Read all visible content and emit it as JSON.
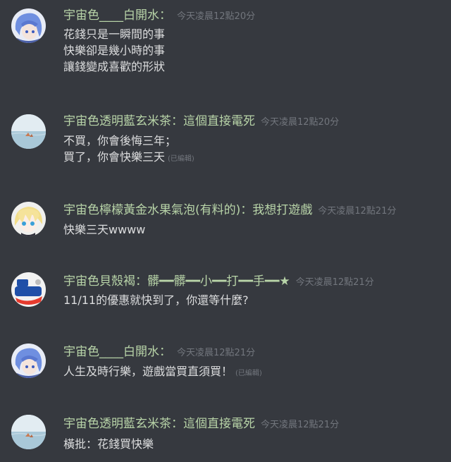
{
  "messages": [
    {
      "author": "宇宙色____白開水：",
      "timestamp": "今天凌晨12點20分",
      "avatar": "blue-hair-anime-avatar",
      "lines": [
        "花錢只是一瞬間的事",
        "快樂卻是幾小時的事",
        "讓錢變成喜歡的形狀"
      ],
      "edited": ""
    },
    {
      "author": "宇宙色透明藍玄米茶：這個直接電死",
      "timestamp": "今天凌晨12點20分",
      "avatar": "sea-scene-avatar",
      "lines": [
        "不買，你會後悔三年；",
        "買了，你會快樂三天"
      ],
      "edited": "(已編輯)"
    },
    {
      "author": "宇宙色檸檬黃金水果氣泡(有料的)：我想打遊戲",
      "timestamp": "今天凌晨12點21分",
      "avatar": "blonde-anime-avatar",
      "lines": [
        "快樂三天wwww"
      ],
      "edited": ""
    },
    {
      "author": "宇宙色貝殼褐：髒━━髒━━小━━打━━手━━★",
      "timestamp": "今天凌晨12點21分",
      "avatar": "mr-sonic-logo-avatar",
      "lines": [
        "11/11的優惠就快到了，你還等什麼?"
      ],
      "edited": ""
    },
    {
      "author": "宇宙色____白開水：",
      "timestamp": "今天凌晨12點21分",
      "avatar": "blue-hair-anime-avatar",
      "lines": [
        "人生及時行樂，遊戲當買直須買！"
      ],
      "edited": "(已編輯)"
    },
    {
      "author": "宇宙色透明藍玄米茶：這個直接電死",
      "timestamp": "今天凌晨12點21分",
      "avatar": "sea-scene-avatar",
      "lines": [
        "橫批：花錢買快樂"
      ],
      "edited": ""
    }
  ]
}
